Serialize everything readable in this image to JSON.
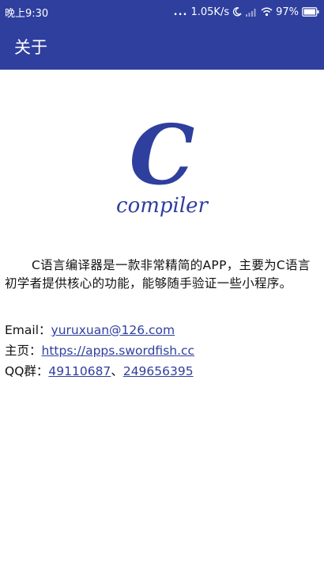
{
  "status_bar": {
    "time": "晚上9:30",
    "dots": "...",
    "network_speed": "1.05K/s",
    "battery_percent": "97%",
    "icons": [
      "moon-icon",
      "signal-icon",
      "wifi-icon",
      "battery-icon"
    ]
  },
  "toolbar": {
    "title": "关于",
    "background_color": "#2f3f9e"
  },
  "logo": {
    "letter": "C",
    "word": "compiler",
    "color": "#2f3f9e"
  },
  "intro": {
    "text": "C语言编译器是一款非常精简的APP，主要为C语言初学者提供核心的功能，能够随手验证一些小程序。"
  },
  "contact": {
    "email_label": "Email：",
    "email": "yuruxuan@126.com",
    "home_label": "主页：",
    "home_url": "https://apps.swordfish.cc",
    "qq_label": "QQ群：",
    "qq_group_1": "49110687",
    "separator": "、",
    "qq_group_2": "249656395"
  },
  "colors": {
    "accent": "#2f3f9e",
    "text": "#111111"
  }
}
